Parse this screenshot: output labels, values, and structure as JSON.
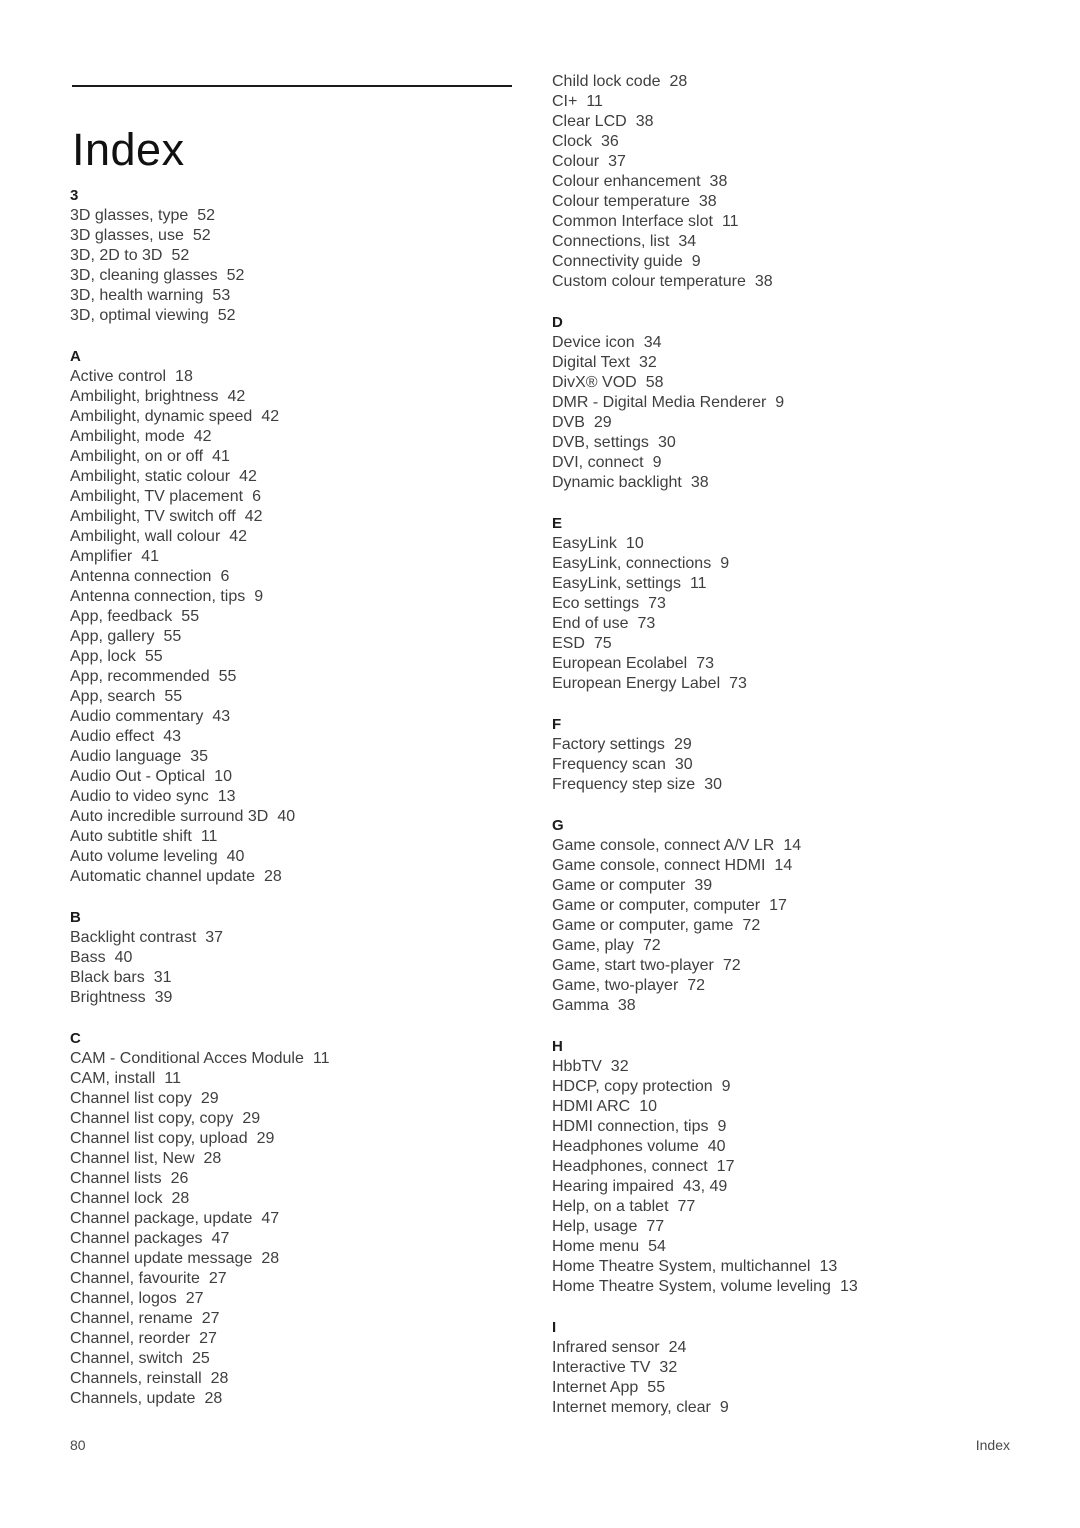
{
  "document": {
    "title": "Index",
    "footer_page_number": "80",
    "footer_label": "Index"
  },
  "columns": [
    {
      "id": "left",
      "sections": [
        {
          "letter": "3",
          "entries": [
            {
              "term": "3D glasses, type",
              "pages": "52"
            },
            {
              "term": "3D glasses, use",
              "pages": "52"
            },
            {
              "term": "3D, 2D to 3D",
              "pages": "52"
            },
            {
              "term": "3D, cleaning glasses",
              "pages": "52"
            },
            {
              "term": "3D, health warning",
              "pages": "53"
            },
            {
              "term": "3D, optimal viewing",
              "pages": "52"
            }
          ]
        },
        {
          "letter": "A",
          "entries": [
            {
              "term": "Active control",
              "pages": "18"
            },
            {
              "term": "Ambilight, brightness",
              "pages": "42"
            },
            {
              "term": "Ambilight, dynamic speed",
              "pages": "42"
            },
            {
              "term": "Ambilight, mode",
              "pages": "42"
            },
            {
              "term": "Ambilight, on or off",
              "pages": "41"
            },
            {
              "term": "Ambilight, static colour",
              "pages": "42"
            },
            {
              "term": "Ambilight, TV placement",
              "pages": "6"
            },
            {
              "term": "Ambilight, TV switch off",
              "pages": "42"
            },
            {
              "term": "Ambilight, wall colour",
              "pages": "42"
            },
            {
              "term": "Amplifier",
              "pages": "41"
            },
            {
              "term": "Antenna connection",
              "pages": "6"
            },
            {
              "term": "Antenna connection, tips",
              "pages": "9"
            },
            {
              "term": "App, feedback",
              "pages": "55"
            },
            {
              "term": "App, gallery",
              "pages": "55"
            },
            {
              "term": "App, lock",
              "pages": "55"
            },
            {
              "term": "App, recommended",
              "pages": "55"
            },
            {
              "term": "App, search",
              "pages": "55"
            },
            {
              "term": "Audio commentary",
              "pages": "43"
            },
            {
              "term": "Audio effect",
              "pages": "43"
            },
            {
              "term": "Audio language",
              "pages": "35"
            },
            {
              "term": "Audio Out - Optical",
              "pages": "10"
            },
            {
              "term": "Audio to video sync",
              "pages": "13"
            },
            {
              "term": "Auto incredible surround 3D",
              "pages": "40"
            },
            {
              "term": "Auto subtitle shift",
              "pages": "11"
            },
            {
              "term": "Auto volume leveling",
              "pages": "40"
            },
            {
              "term": "Automatic channel update",
              "pages": "28"
            }
          ]
        },
        {
          "letter": "B",
          "entries": [
            {
              "term": "Backlight contrast",
              "pages": "37"
            },
            {
              "term": "Bass",
              "pages": "40"
            },
            {
              "term": "Black bars",
              "pages": "31"
            },
            {
              "term": "Brightness",
              "pages": "39"
            }
          ]
        },
        {
          "letter": "C",
          "entries": [
            {
              "term": "CAM - Conditional Acces Module",
              "pages": "11"
            },
            {
              "term": "CAM, install",
              "pages": "11"
            },
            {
              "term": "Channel list copy",
              "pages": "29"
            },
            {
              "term": "Channel list copy, copy",
              "pages": "29"
            },
            {
              "term": "Channel list copy, upload",
              "pages": "29"
            },
            {
              "term": "Channel list, New",
              "pages": "28"
            },
            {
              "term": "Channel lists",
              "pages": "26"
            },
            {
              "term": "Channel lock",
              "pages": "28"
            },
            {
              "term": "Channel package, update",
              "pages": "47"
            },
            {
              "term": "Channel packages",
              "pages": "47"
            },
            {
              "term": "Channel update message",
              "pages": "28"
            },
            {
              "term": "Channel, favourite",
              "pages": "27"
            },
            {
              "term": "Channel, logos",
              "pages": "27"
            },
            {
              "term": "Channel, rename",
              "pages": "27"
            },
            {
              "term": "Channel, reorder",
              "pages": "27"
            },
            {
              "term": "Channel, switch",
              "pages": "25"
            },
            {
              "term": "Channels, reinstall",
              "pages": "28"
            },
            {
              "term": "Channels, update",
              "pages": "28"
            }
          ]
        }
      ]
    },
    {
      "id": "right",
      "sections": [
        {
          "letter": "",
          "entries": [
            {
              "term": "Child lock code",
              "pages": "28"
            },
            {
              "term": "CI+",
              "pages": "11"
            },
            {
              "term": "Clear LCD",
              "pages": "38"
            },
            {
              "term": "Clock",
              "pages": "36"
            },
            {
              "term": "Colour",
              "pages": "37"
            },
            {
              "term": "Colour enhancement",
              "pages": "38"
            },
            {
              "term": "Colour temperature",
              "pages": "38"
            },
            {
              "term": "Common Interface slot",
              "pages": "11"
            },
            {
              "term": "Connections, list",
              "pages": "34"
            },
            {
              "term": "Connectivity guide",
              "pages": "9"
            },
            {
              "term": "Custom colour temperature",
              "pages": "38"
            }
          ]
        },
        {
          "letter": "D",
          "entries": [
            {
              "term": "Device icon",
              "pages": "34"
            },
            {
              "term": "Digital Text",
              "pages": "32"
            },
            {
              "term": "DivX® VOD",
              "pages": "58"
            },
            {
              "term": "DMR - Digital Media Renderer",
              "pages": "9"
            },
            {
              "term": "DVB",
              "pages": "29"
            },
            {
              "term": "DVB, settings",
              "pages": "30"
            },
            {
              "term": "DVI, connect",
              "pages": "9"
            },
            {
              "term": "Dynamic backlight",
              "pages": "38"
            }
          ]
        },
        {
          "letter": "E",
          "entries": [
            {
              "term": "EasyLink",
              "pages": "10"
            },
            {
              "term": "EasyLink, connections",
              "pages": "9"
            },
            {
              "term": "EasyLink, settings",
              "pages": "11"
            },
            {
              "term": "Eco settings",
              "pages": "73"
            },
            {
              "term": "End of use",
              "pages": "73"
            },
            {
              "term": "ESD",
              "pages": "75"
            },
            {
              "term": "European Ecolabel",
              "pages": "73"
            },
            {
              "term": "European Energy Label",
              "pages": "73"
            }
          ]
        },
        {
          "letter": "F",
          "entries": [
            {
              "term": "Factory settings",
              "pages": "29"
            },
            {
              "term": "Frequency scan",
              "pages": "30"
            },
            {
              "term": "Frequency step size",
              "pages": "30"
            }
          ]
        },
        {
          "letter": "G",
          "entries": [
            {
              "term": "Game console, connect A/V LR",
              "pages": "14"
            },
            {
              "term": "Game console, connect HDMI",
              "pages": "14"
            },
            {
              "term": "Game or computer",
              "pages": "39"
            },
            {
              "term": "Game or computer, computer",
              "pages": "17"
            },
            {
              "term": "Game or computer, game",
              "pages": "72"
            },
            {
              "term": "Game, play",
              "pages": "72"
            },
            {
              "term": "Game, start two-player",
              "pages": "72"
            },
            {
              "term": "Game, two-player",
              "pages": "72"
            },
            {
              "term": "Gamma",
              "pages": "38"
            }
          ]
        },
        {
          "letter": "H",
          "entries": [
            {
              "term": "HbbTV",
              "pages": "32"
            },
            {
              "term": "HDCP, copy protection",
              "pages": "9"
            },
            {
              "term": "HDMI ARC",
              "pages": "10"
            },
            {
              "term": "HDMI connection, tips",
              "pages": "9"
            },
            {
              "term": "Headphones volume",
              "pages": "40"
            },
            {
              "term": "Headphones, connect",
              "pages": "17"
            },
            {
              "term": "Hearing impaired",
              "pages": "43, 49"
            },
            {
              "term": "Help, on a tablet",
              "pages": "77"
            },
            {
              "term": "Help, usage",
              "pages": "77"
            },
            {
              "term": "Home menu",
              "pages": "54"
            },
            {
              "term": "Home Theatre System, multichannel",
              "pages": "13"
            },
            {
              "term": "Home Theatre System, volume leveling",
              "pages": "13"
            }
          ]
        },
        {
          "letter": "I",
          "entries": [
            {
              "term": "Infrared sensor",
              "pages": "24"
            },
            {
              "term": "Interactive TV",
              "pages": "32"
            },
            {
              "term": "Internet App",
              "pages": "55"
            },
            {
              "term": "Internet memory, clear",
              "pages": "9"
            }
          ]
        }
      ]
    }
  ]
}
